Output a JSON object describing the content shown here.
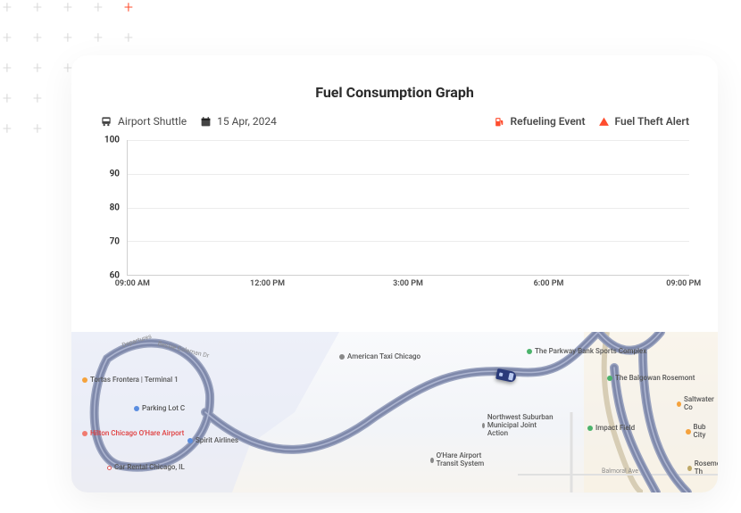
{
  "header": {
    "title": "Fuel Consumption Graph"
  },
  "meta": {
    "vehicle": "Airport Shuttle",
    "date": "15 Apr, 2024"
  },
  "legend": {
    "refuel": "Refueling Event",
    "theft": "Fuel Theft Alert"
  },
  "chart_data": {
    "type": "line",
    "title": "Fuel Consumption Graph",
    "xlabel": "",
    "ylabel": "",
    "ylim": [
      60,
      100
    ],
    "y_ticks": [
      60,
      70,
      80,
      90,
      100
    ],
    "x_ticks": [
      "09:00 AM",
      "12:00 PM",
      "3:00 PM",
      "6:00 PM",
      "09:00 PM"
    ],
    "series": []
  },
  "map": {
    "pois": {
      "tortas": "Tortas Frontera | Terminal 1",
      "parking": "Parking Lot C",
      "hilton": "Hilton Chicago O'Hare Airport",
      "spirit": "Spirit Airlines",
      "car_rental": "Car Rental Chicago, IL",
      "taxi": "American Taxi Chicago",
      "parkway": "The Parkway Bank Sports Complex",
      "balgowan": "The Balgowan Rosemont",
      "suburban": "Northwest Suburban Municipal Joint Action",
      "transit": "O'Hare Airport Transit System",
      "saltwater": "Saltwater Co",
      "impact": "Impact Field",
      "bub": "Bub City",
      "rosemont": "Rosemont Th"
    },
    "streets": {
      "departures": "Departures",
      "balmoral": "Balmoral Ave",
      "bessie": "Bessie Coleman Dr"
    }
  }
}
